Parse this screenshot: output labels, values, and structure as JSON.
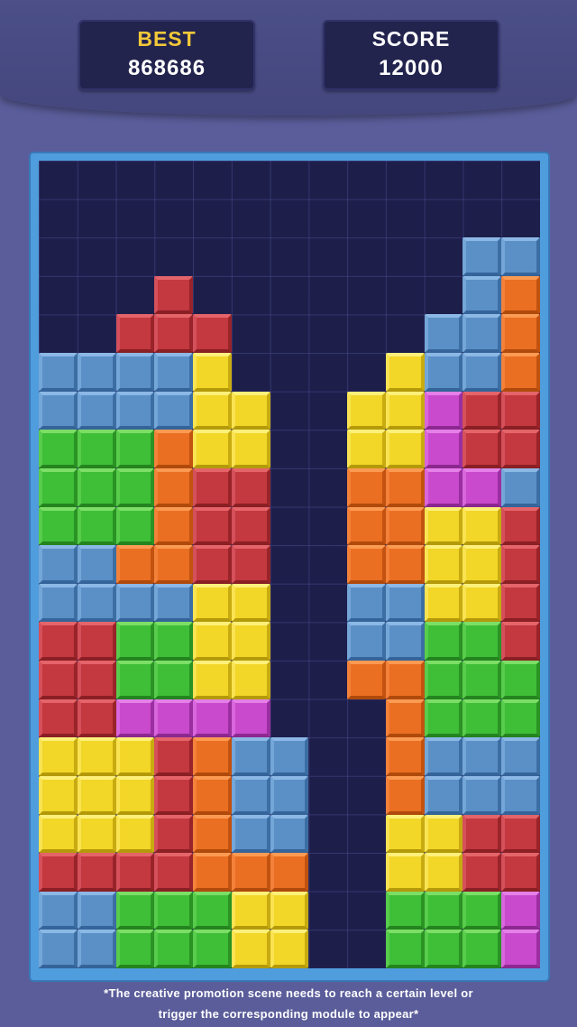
{
  "hud": {
    "best_label": "BEST",
    "best_value": "868686",
    "score_label": "SCORE",
    "score_value": "12000"
  },
  "board": {
    "columns": 13,
    "rows": 21,
    "palette": {
      "r": "#c4383f",
      "o": "#ea6f22",
      "y": "#f2d628",
      "g": "#3fbe38",
      "b": "#5b90c7",
      "p": "#c94acd"
    },
    "grid": [
      ".............",
      ".............",
      "...........bb",
      "...r.......boo",
      "..rrr.....bboo",
      "bbbby....ybboo",
      "bbbbyy..yyprrr",
      "gggoyy..yyprrr",
      "gggorr..ooppb",
      "gggorr..ooyyrb",
      "bboorr..ooyyrb",
      "bbbbyy..bbyyrb",
      "rrggyy..bbggrp",
      "rrggyy..oogggpp",
      "rrpppp...ogggpp",
      "yyyrobb..obbbb",
      "yyyrobb..obbbb",
      "yyyrobb..yyrrr",
      "rrrrooo..yyrrr",
      "bbgggyy..gggpp",
      "bbgggyy..gggpp",
      "bbgggyy..bbbpp"
    ]
  },
  "footer": {
    "line1": "*The creative promotion scene needs to reach a certain level or",
    "line2": "trigger the corresponding module to appear*"
  }
}
